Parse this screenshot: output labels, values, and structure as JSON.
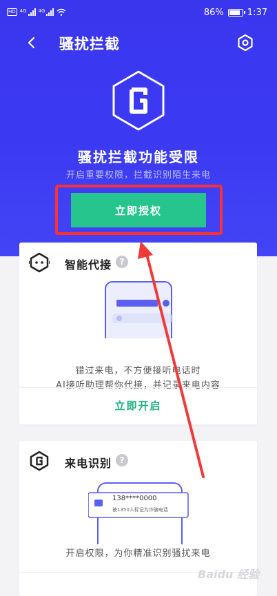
{
  "status_bar": {
    "hd_tag": "HD",
    "signal1_label": "4G",
    "signal2_label": "4G",
    "battery": "86%",
    "time": "1:37"
  },
  "header": {
    "title": "骚扰拦截",
    "back_icon": "chevron-left-icon",
    "settings_icon": "hex-gear-icon"
  },
  "hero": {
    "headline": "骚扰拦截功能受限",
    "subline": "开启重要权限，拦截识别陌生来电",
    "cta_label": "立即授权"
  },
  "cards": [
    {
      "title": "智能代接",
      "icon": "robot-icon",
      "desc_line1": "错过来电，不方便接听电话时",
      "desc_line2": "AI接听助理帮你代接，并记录来电内容",
      "action": "立即开启"
    },
    {
      "title": "来电识别",
      "icon": "hex-logo-icon",
      "call_number": "138****0000",
      "call_note": "被1350人标记为诈骗电话",
      "desc_line1": "开启权限，为你精准识别骚扰来电"
    }
  ],
  "watermark": "Baidu 经验",
  "colors": {
    "hero_blue": "#3b3af2",
    "cta_green": "#25c58d",
    "action_green": "#1db37f",
    "annotation_red": "#ff3030"
  }
}
